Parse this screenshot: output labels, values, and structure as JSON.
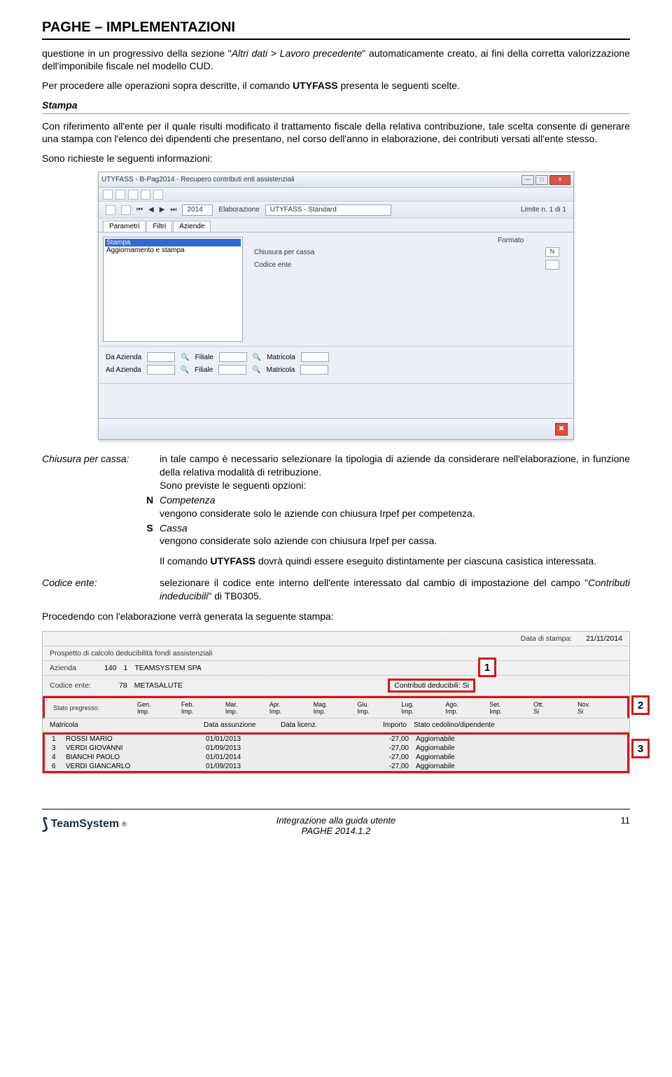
{
  "header": "PAGHE – IMPLEMENTAZIONI",
  "intro_p1_a": "questione in un progressivo della sezione \"",
  "intro_p1_b": "Altri dati > Lavoro precedente",
  "intro_p1_c": "\" automaticamente creato, ai fini della corretta valorizzazione dell'imponibile fiscale nel modello CUD.",
  "intro_p2_a": "Per procedere alle operazioni sopra descritte, il comando ",
  "intro_p2_b": "UTYFASS",
  "intro_p2_c": " presenta le seguenti scelte.",
  "section_title": "Stampa",
  "section_p1": "Con riferimento all'ente per il quale risulti modificato il trattamento fiscale della relativa contribuzione, tale scelta consente di generare una stampa con l'elenco dei dipendenti che presentano, nel corso dell'anno in elaborazione, dei contributi versati all'ente stesso.",
  "section_p2": "Sono richieste le seguenti informazioni:",
  "ss": {
    "title": "UTYFASS - B-Pag2014 - Recupero contributi enti assistenziali",
    "year": "2014",
    "elab_label": "Elaborazione",
    "elab_value": "UTYFASS - Standard",
    "limit": "Limite n. 1 di 1",
    "tabs": [
      "Parametri",
      "Filtri",
      "Aziende"
    ],
    "list_sel": "Stampa",
    "list_item": "Aggiornamento e stampa",
    "r_formato": "Formato",
    "r_chiusura": "Chiusura per cassa",
    "r_chiusura_val": "N",
    "r_codice": "Codice ente",
    "l_da": "Da Azienda",
    "l_ad": "Ad Azienda",
    "l_fil": "Filiale",
    "l_mat": "Matricola"
  },
  "defs": {
    "lab1": "Chiusura per cassa:",
    "t1": "in tale campo è necessario selezionare la tipologia di aziende da considerare nell'elaborazione, in funzione della relativa modalità di retribuzione.",
    "t1b": "Sono previste le seguenti opzioni:",
    "optN": "N",
    "optN_t": "Competenza",
    "optN_d": "vengono considerate solo le aziende con chiusura Irpef per competenza.",
    "optS": "S",
    "optS_t": "Cassa",
    "optS_d": "vengono considerate solo aziende con chiusura Irpef per cassa.",
    "t_post_a": "Il comando ",
    "t_post_b": "UTYFASS",
    "t_post_c": " dovrà quindi essere eseguito distintamente per ciascuna casistica interessata.",
    "lab2": "Codice ente:",
    "t2_a": "selezionare il codice ente interno dell'ente interessato dal cambio di impostazione del campo \"",
    "t2_b": "Contributi indeducibili",
    "t2_c": "\" di TB0305."
  },
  "pre_report": "Procedendo con l'elaborazione verrà generata la seguente stampa:",
  "report": {
    "date_lbl": "Data di stampa:",
    "date_val": "21/11/2014",
    "title": "Prospetto di calcolo deducibilità fondi assistenziali",
    "az_lbl": "Azienda",
    "az_n1": "140",
    "az_n2": "1",
    "az_name": "TEAMSYSTEM SPA",
    "ce_lbl": "Codice ente:",
    "ce_val": "78",
    "ce_name": "METASALUTE",
    "cd_lbl": "Contributi deducibili: Si",
    "sp_lbl": "Stato pregresso:",
    "months": [
      {
        "m": "Gen.",
        "s": "Imp."
      },
      {
        "m": "Feb.",
        "s": "Imp."
      },
      {
        "m": "Mar.",
        "s": "Imp."
      },
      {
        "m": "Apr.",
        "s": "Imp."
      },
      {
        "m": "Mag.",
        "s": "Imp."
      },
      {
        "m": "Giu.",
        "s": "Imp."
      },
      {
        "m": "Lug.",
        "s": "Imp."
      },
      {
        "m": "Ago.",
        "s": "Imp."
      },
      {
        "m": "Set.",
        "s": "Imp."
      },
      {
        "m": "Ott.",
        "s": "Si"
      },
      {
        "m": "Nov.",
        "s": "Si"
      }
    ],
    "dh": [
      "Matricola",
      "Data assunzione",
      "Data licenz.",
      "Importo",
      "Stato cedolino/dipendente"
    ],
    "rows": [
      {
        "n": "1",
        "nm": "ROSSI MARIO",
        "da": "01/01/2013",
        "dl": "",
        "imp": "-27,00",
        "st": "Aggiornabile"
      },
      {
        "n": "3",
        "nm": "VERDI GIOVANNI",
        "da": "01/09/2013",
        "dl": "",
        "imp": "-27,00",
        "st": "Aggiornabile"
      },
      {
        "n": "4",
        "nm": "BIANCHI PAOLO",
        "da": "01/01/2014",
        "dl": "",
        "imp": "-27,00",
        "st": "Aggiornabile"
      },
      {
        "n": "6",
        "nm": "VERDI GIANCARLO",
        "da": "01/09/2013",
        "dl": "",
        "imp": "-27,00",
        "st": "Aggiornabile"
      }
    ],
    "callouts": {
      "c1": "1",
      "c2": "2",
      "c3": "3"
    }
  },
  "footer": {
    "brand": "TeamSystem",
    "reg": "®",
    "center1": "Integrazione alla guida utente",
    "center2": "PAGHE 2014.1.2",
    "page": "11"
  }
}
